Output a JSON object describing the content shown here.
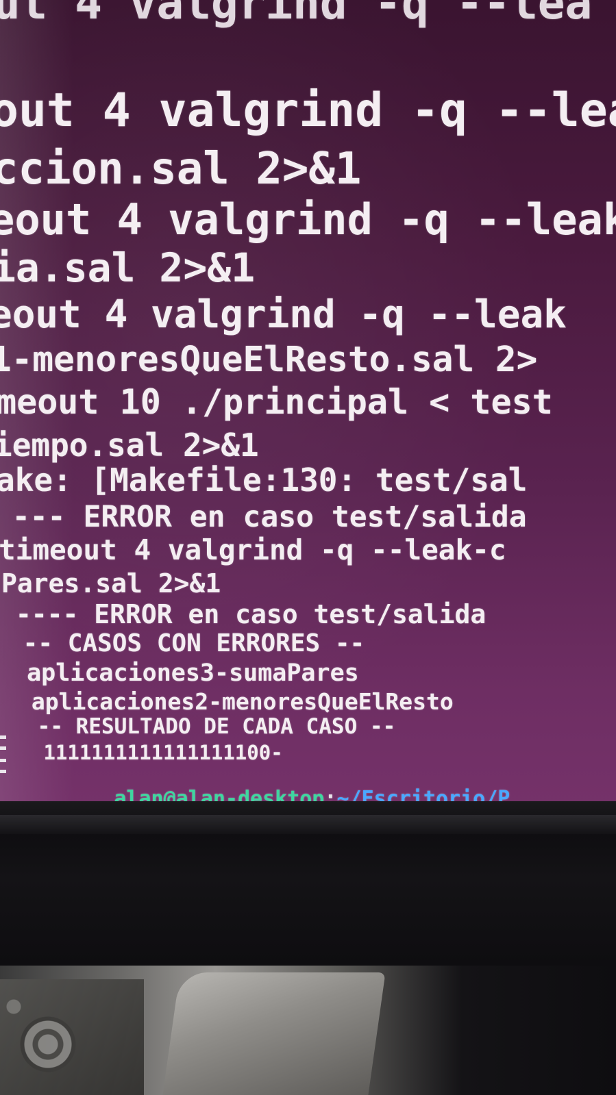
{
  "terminal": {
    "lines": [
      "ut 4 valgrind -q --lea",
      "out 4 valgrind -q --lea",
      "ccion.sal 2>&1",
      "eout 4 valgrind -q --leak",
      "ia.sal 2>&1",
      "eout 4 valgrind -q --leak",
      "1-menoresQueElResto.sal 2>",
      "meout 10 ./principal < test",
      "iempo.sal 2>&1",
      "ake: [Makefile:130: test/sal",
      " --- ERROR en caso test/salida",
      "timeout 4 valgrind -q --leak-c",
      "Pares.sal 2>&1",
      " ---- ERROR en caso test/salida",
      " -- CASOS CON ERRORES --",
      " aplicaciones3-sumaPares",
      " aplicaciones2-menoresQueElResto",
      " -- RESULTADO DE CADA CASO --",
      " 1111111111111111100-"
    ],
    "prompt_user": "alan@alan-desktop",
    "prompt_sep": ":",
    "prompt_path": "~/Escritorio/P"
  },
  "colors": {
    "background": "#5a2350",
    "text": "#f4eef2",
    "prompt_user": "#3fd6a0",
    "prompt_path": "#4aa8ff"
  }
}
